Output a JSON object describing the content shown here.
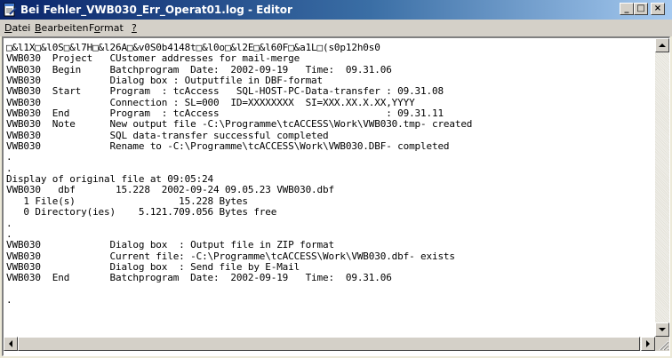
{
  "window": {
    "title": "Bei Fehler_VWB030_Err_Operat01.log - Editor",
    "title_icon": "notepad-icon",
    "controls": {
      "minimize": "_",
      "maximize": "□",
      "close": "×"
    }
  },
  "menu": {
    "datei": {
      "underline": "D",
      "rest": "atei"
    },
    "bearbeiten": {
      "underline": "B",
      "rest": "earbeiten"
    },
    "format": {
      "pre": "F",
      "underline": "o",
      "rest": "rmat"
    },
    "help": {
      "underline": "?"
    }
  },
  "editor": {
    "lines": [
      "□&l1X□&l0S□&l7H□&l26A□&v0S0b4148t□&l0o□&l2E□&l60F□&a1L□(s0p12h0s0",
      "VWB030  Project   CUstomer addresses for mail-merge",
      "VWB030  Begin     Batchprogram  Date:  2002-09-19   Time:  09.31.06",
      "VWB030            Dialog box : Outputfile in DBF-format",
      "VWB030  Start     Program  : tcAccess   SQL-HOST-PC-Data-transfer : 09.31.08",
      "VWB030            Connection : SL=000  ID=XXXXXXXX  SI=XXX.XX.X.XX,YYYY",
      "VWB030  End       Program  : tcAccess                             : 09.31.11",
      "VWB030  Note      New output file -C:\\Programme\\tcACCESS\\Work\\VWB030.tmp- created",
      "VWB030            SQL data-transfer successful completed",
      "VWB030            Rename to -C:\\Programme\\tcACCESS\\Work\\VWB030.DBF- completed",
      ".",
      ".",
      "Display of original file at 09:05:24",
      "VWB030   dbf       15.228  2002-09-24 09.05.23 VWB030.dbf",
      "   1 File(s)                  15.228 Bytes",
      "   0 Directory(ies)    5.121.709.056 Bytes free",
      ".",
      ".",
      "VWB030            Dialog box  : Output file in ZIP format",
      "VWB030            Current file: -C:\\Programme\\tcACCESS\\Work\\VWB030.dbf- exists",
      "VWB030            Dialog box  : Send file by E-Mail",
      "VWB030  End       Batchprogram  Date:  2002-09-19   Time:  09.31.06",
      "",
      "."
    ]
  },
  "colors": {
    "titlebar_start": "#0a246a",
    "titlebar_end": "#a6caf0",
    "chrome": "#d4d0c8"
  }
}
